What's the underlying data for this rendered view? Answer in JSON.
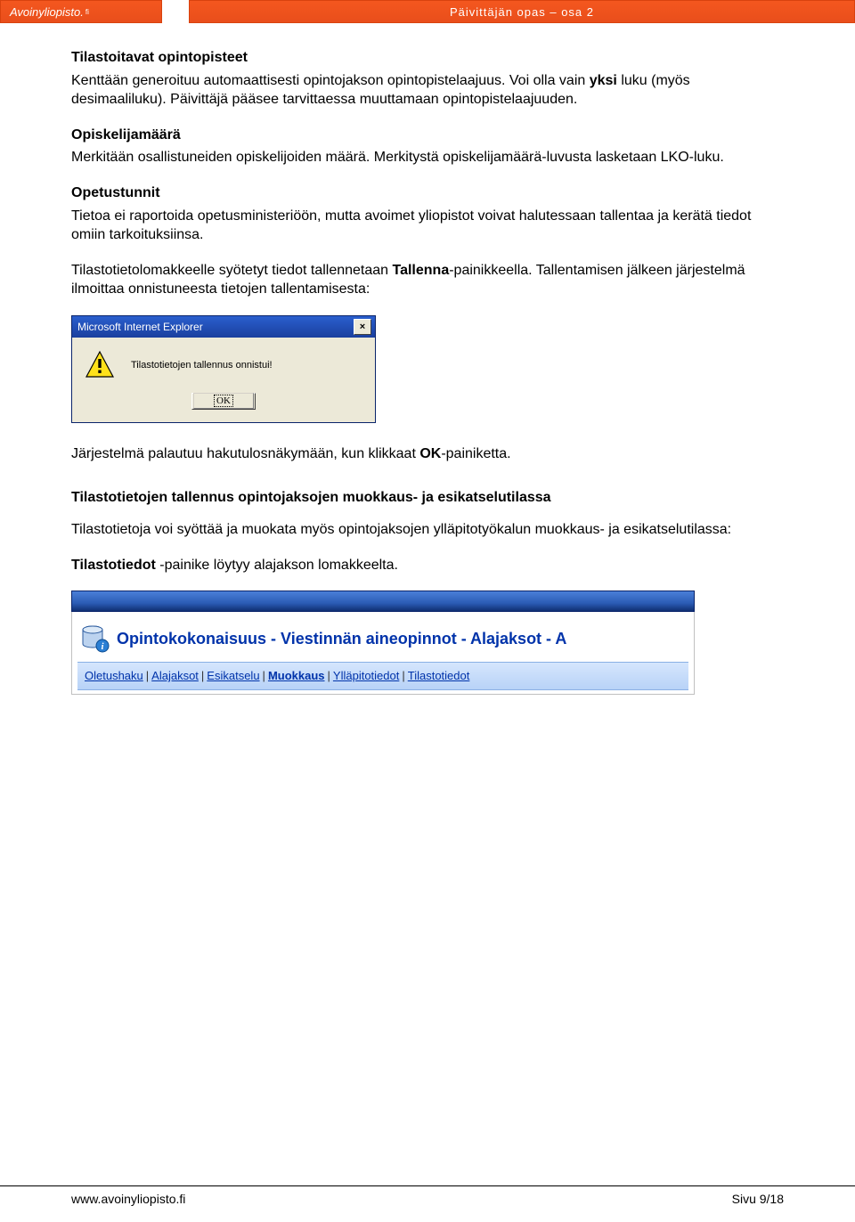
{
  "header": {
    "logo": "Avoinyliopisto.",
    "title": "Päivittäjän opas – osa 2"
  },
  "sections": {
    "s1": {
      "heading": "Tilastoitavat opintopisteet",
      "text_a": "Kenttään generoituu automaattisesti opintojakson opintopistelaajuus. Voi olla vain ",
      "text_bold1": "yksi",
      "text_b": " luku (myös desimaaliluku). Päivittäjä pääsee tarvittaessa muuttamaan opintopistelaajuuden."
    },
    "s2": {
      "heading": "Opiskelijamäärä",
      "text": "Merkitään osallistuneiden opiskelijoiden määrä. Merkitystä opiskelijamäärä-luvusta lasketaan LKO-luku."
    },
    "s3": {
      "heading": "Opetustunnit",
      "text": "Tietoa ei raportoida opetusministeriöön, mutta avoimet yliopistot voivat halutessaan tallentaa ja kerätä tiedot omiin tarkoituksiinsa."
    },
    "s4": {
      "text_a": "Tilastotietolomakkeelle syötetyt tiedot tallennetaan ",
      "text_bold": "Tallenna",
      "text_b": "-painikkeella. Tallentamisen jälkeen järjestelmä ilmoittaa onnistuneesta tietojen tallentamisesta:"
    },
    "s5": {
      "text_a": "Järjestelmä palautuu hakutulosnäkymään, kun klikkaat ",
      "text_bold": "OK",
      "text_b": "-painiketta."
    },
    "s6": {
      "heading": "Tilastotietojen tallennus opintojaksojen muokkaus- ja esikatselutilassa",
      "text": "Tilastotietoja voi syöttää ja muokata myös opintojaksojen ylläpitotyökalun muokkaus- ja esikatselutilassa:"
    },
    "s7": {
      "text_bold": "Tilastotiedot",
      "text_b": " -painike löytyy alajakson lomakkeelta."
    }
  },
  "dialog": {
    "title": "Microsoft Internet Explorer",
    "message": "Tilastotietojen tallennus onnistui!",
    "ok": "OK"
  },
  "nav": {
    "breadcrumb": "Opintokokonaisuus - Viestinnän aineopinnot - Alajaksot - A",
    "links": [
      "Oletushaku",
      "Alajaksot",
      "Esikatselu",
      "Muokkaus",
      "Ylläpitotiedot",
      "Tilastotiedot"
    ],
    "active_index": 3
  },
  "footer": {
    "left": "www.avoinyliopisto.fi",
    "right": "Sivu 9/18"
  }
}
